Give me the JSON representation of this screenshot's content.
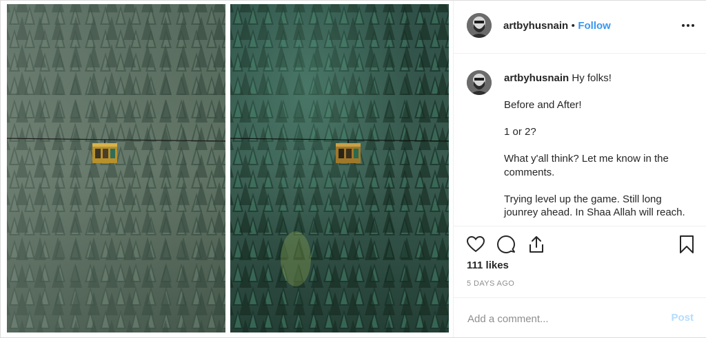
{
  "post": {
    "username": "artbyhusnain",
    "separator": "•",
    "follow_label": "Follow",
    "caption_lines": [
      "Hy folks!",
      "",
      "Before and After!",
      "",
      "1 or 2?",
      "",
      "What y'all think? Let me know in the comments.",
      "",
      "Trying level up the game. Still long jounrey ahead. In Shaa Allah will reach."
    ],
    "likes": "111 likes",
    "timestamp": "5 DAYS AGO"
  },
  "comment": {
    "placeholder": "Add a comment...",
    "post_label": "Post"
  },
  "colors": {
    "follow": "#3897f0",
    "post_disabled": "#b3dbff",
    "before_tint": "#556b5a",
    "after_tint": "#2f5a52"
  },
  "icons": [
    "more-icon",
    "heart-icon",
    "comment-icon",
    "share-icon",
    "bookmark-icon"
  ]
}
